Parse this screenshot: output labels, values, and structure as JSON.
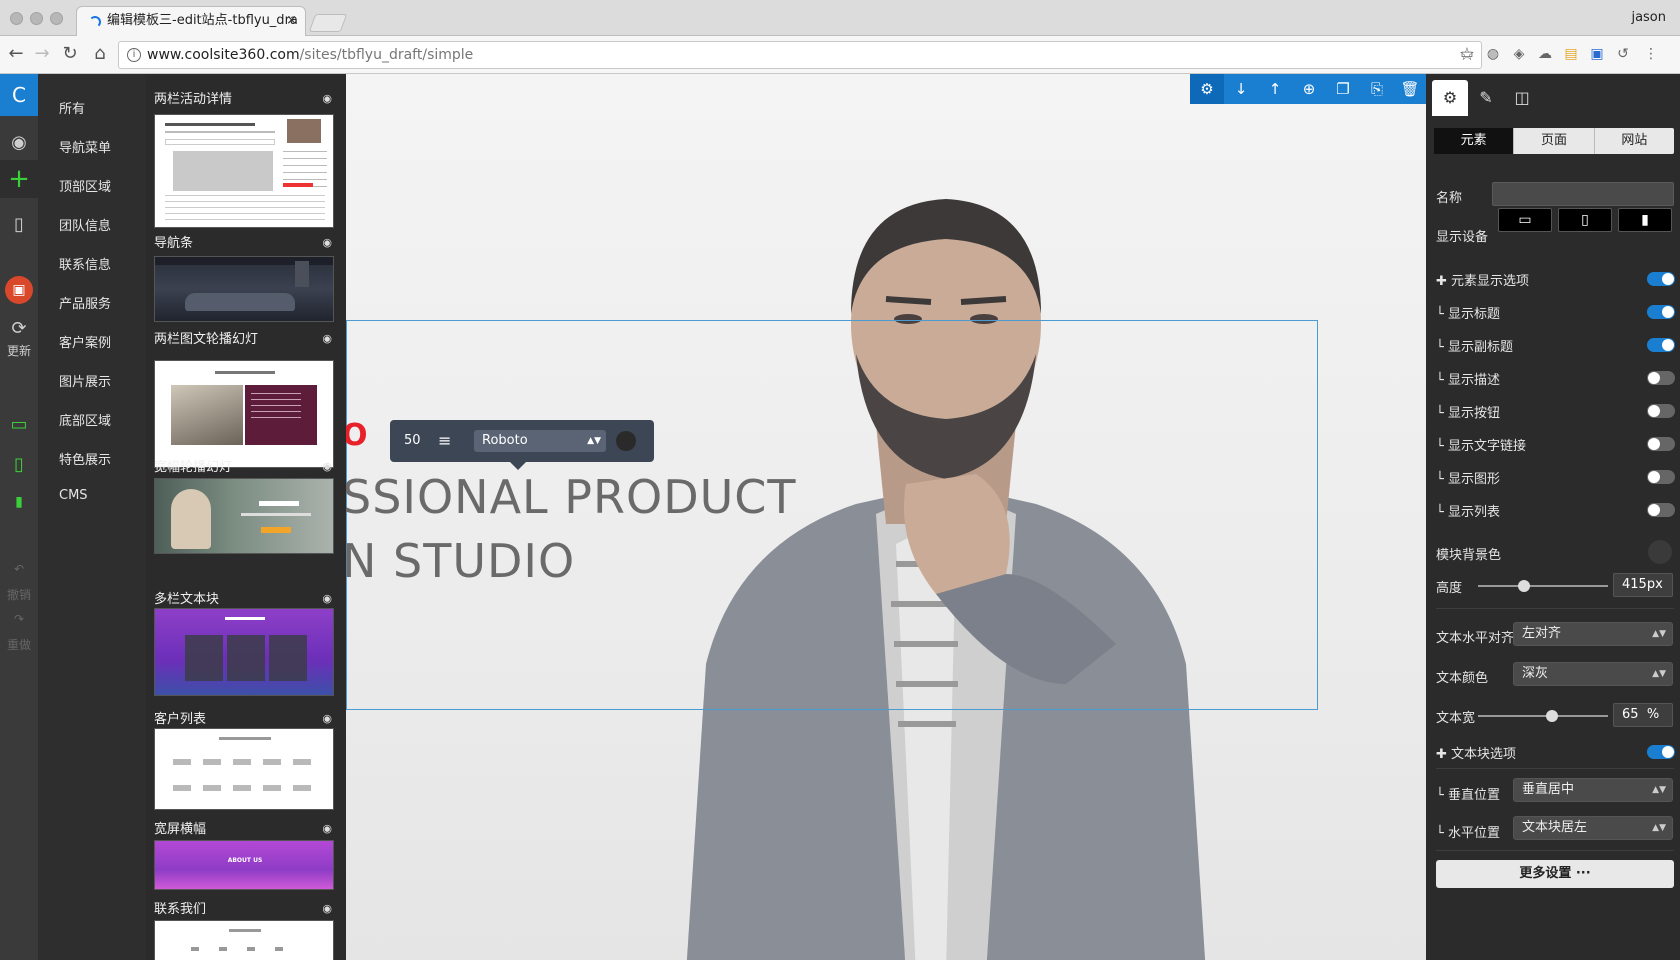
{
  "browser": {
    "tab_title": "编辑模板三-edit站点-tbflyu_dra",
    "tab_close": "×",
    "profile_name": "jason",
    "url_domain": "www.coolsite360.com",
    "url_path": "/sites/tbflyu_draft/simple"
  },
  "rail": {
    "logo": "C",
    "update_label": "更新",
    "undo_label": "撤销",
    "redo_label": "重做"
  },
  "categories": [
    "所有",
    "导航菜单",
    "顶部区域",
    "团队信息",
    "联系信息",
    "产品服务",
    "客户案例",
    "图片展示",
    "底部区域",
    "特色展示",
    "CMS"
  ],
  "templates": [
    {
      "title": "两栏活动详情"
    },
    {
      "title": "导航条"
    },
    {
      "title": "两栏图文轮播幻灯"
    },
    {
      "title": "宽幅轮播幻灯"
    },
    {
      "title": "多栏文本块"
    },
    {
      "title": "客户列表"
    },
    {
      "title": "宽屏横幅"
    },
    {
      "title": "联系我们"
    }
  ],
  "thumb_text": {
    "wide_banner": "ABOUT US"
  },
  "canvas": {
    "hero_line1": "O N",
    "hero_line2": "SSIONAL PRODUCT",
    "hero_line3": "N STUDIO",
    "text_tool_size": "50",
    "text_tool_font": "Roboto"
  },
  "settings": {
    "tabs": [
      "元素",
      "页面",
      "网站"
    ],
    "name_label": "名称",
    "name_value": "",
    "device_label": "显示设备",
    "element_display_options": "元素显示选项",
    "show_items": [
      {
        "label": "显示标题",
        "on": true
      },
      {
        "label": "显示副标题",
        "on": true
      },
      {
        "label": "显示描述",
        "on": false
      },
      {
        "label": "显示按钮",
        "on": false
      },
      {
        "label": "显示文字链接",
        "on": false
      },
      {
        "label": "显示图形",
        "on": false
      },
      {
        "label": "显示列表",
        "on": false
      }
    ],
    "bg_color_label": "模块背景色",
    "height_label": "高度",
    "height_value": "415px",
    "text_align_label": "文本水平对齐",
    "text_align_value": "左对齐",
    "text_color_label": "文本颜色",
    "text_color_value": "深灰",
    "text_width_label": "文本宽",
    "text_width_value": "65",
    "text_width_unit": "%",
    "text_block_options": "文本块选项",
    "vertical_pos_label": "垂直位置",
    "vertical_pos_value": "垂直居中",
    "horizontal_pos_label": "水平位置",
    "horizontal_pos_value": "文本块居左",
    "more_settings": "更多设置 ···"
  },
  "colors": {
    "accent": "#1b7fd1",
    "hero_red": "#e8202a"
  }
}
